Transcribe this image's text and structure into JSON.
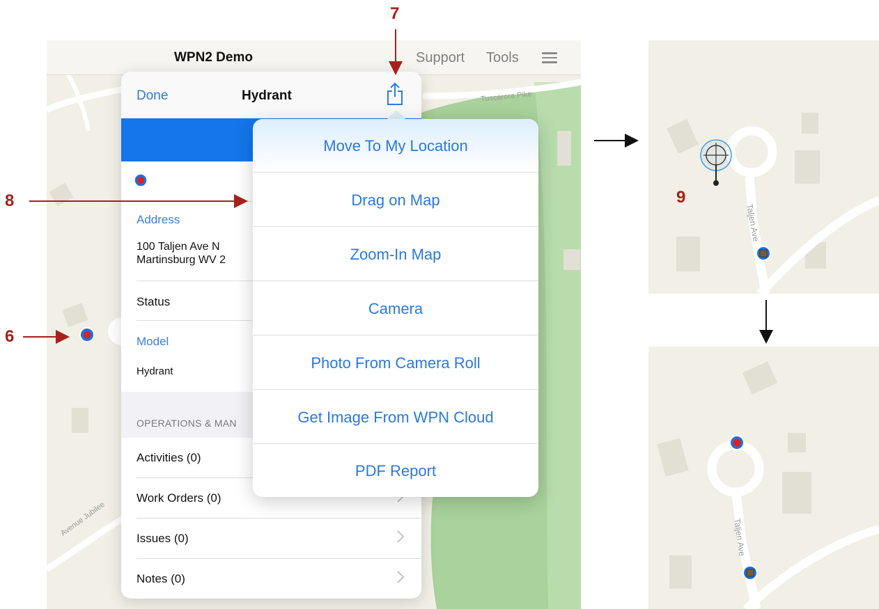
{
  "app": {
    "title": "WPN2 Demo",
    "nav_links": [
      "Support",
      "Tools"
    ],
    "menu_icon": "hamburger-icon"
  },
  "map": {
    "road_labels": [
      "Tuscarora Pike",
      "Avenue Jubilee",
      "Taljen Ave"
    ]
  },
  "panel": {
    "done_label": "Done",
    "title": "Hydrant",
    "share_icon": "share-icon",
    "address_label": "Address",
    "address_lines": [
      "100 Taljen Ave N",
      "Martinsburg WV 2"
    ],
    "status_label": "Status",
    "model_label": "Model",
    "model_value": "Hydrant",
    "section_header": "OPERATIONS & MAN",
    "rows": [
      {
        "label": "Activities  (0)"
      },
      {
        "label": "Work Orders  (0)"
      },
      {
        "label": "Issues  (0)"
      },
      {
        "label": "Notes  (0)"
      }
    ]
  },
  "share_menu": {
    "items": [
      "Move To My Location",
      "Drag on Map",
      "Zoom-In Map",
      "Camera",
      "Photo From Camera Roll",
      "Get Image From WPN Cloud",
      "PDF Report"
    ]
  },
  "annotations": {
    "step_6": "6",
    "step_7": "7",
    "step_8": "8",
    "step_9": "9"
  },
  "colors": {
    "accent_blue": "#2a78e4",
    "header_band": "#1476ea",
    "annotation_red": "#a8201a",
    "marker_red": "#e0201c",
    "marker_blue": "#1f6fe0",
    "map_background": "#f1efe6",
    "park_green": "#a9d29c"
  }
}
